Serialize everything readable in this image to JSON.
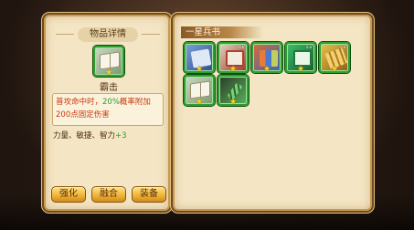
{
  "detail": {
    "title": "物品详情",
    "item_name": "霸击",
    "item_icon": "book-icon",
    "desc_prefix": "普攻命中时，",
    "desc_pct": "20%",
    "desc_suffix": "概率附加200点固定伤害",
    "stats_text": "力量、敏捷、智力",
    "stats_bonus": "+3",
    "buttons": [
      "强化",
      "融合",
      "装备"
    ]
  },
  "inventory": {
    "category_tab": "一星兵书",
    "items": [
      {
        "icon": "blue-book-icon",
        "stars": "★"
      },
      {
        "icon": "red-book-icon",
        "stars": "★",
        "level": "Lv"
      },
      {
        "icon": "scroll-bundle-icon",
        "stars": "★"
      },
      {
        "icon": "green-book-icon",
        "stars": "★",
        "level": "Lv"
      },
      {
        "icon": "gold-scroll-icon",
        "stars": "★",
        "level": "Lv"
      },
      {
        "icon": "open-book-icon",
        "stars": "★"
      },
      {
        "icon": "bamboo-slip-icon",
        "stars": "★"
      }
    ]
  },
  "colors": {
    "panel_bg": "#f4e6c4",
    "frame_green": "#2f9e2f",
    "desc_red": "#c63a10",
    "bonus_green": "#2a9a2a",
    "button_gold": "#f0b63a"
  }
}
